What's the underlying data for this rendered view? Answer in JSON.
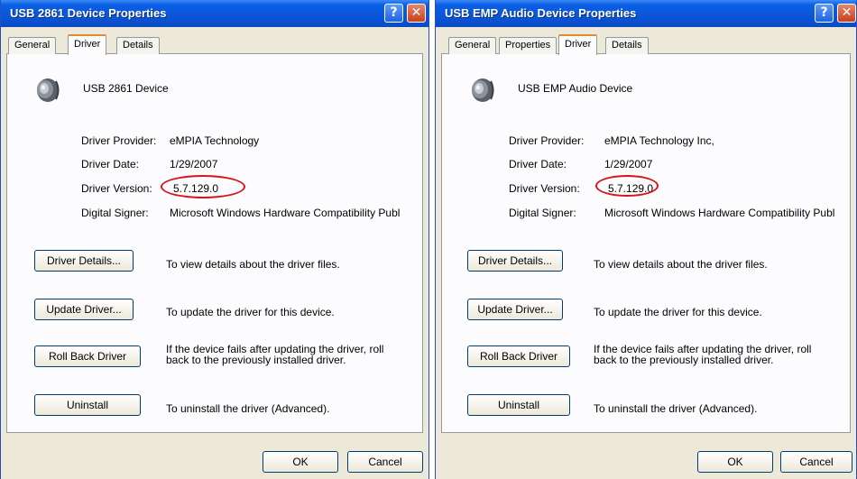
{
  "windows": [
    {
      "title": "USB 2861 Device Properties",
      "help_glyph": "?",
      "close_glyph": "✕",
      "tabs": [
        {
          "label": "General"
        },
        {
          "label": "Driver"
        },
        {
          "label": "Details"
        }
      ],
      "active_tab": "Driver",
      "device_icon": "speaker-icon",
      "device_name": "USB 2861 Device",
      "fields": [
        {
          "label": "Driver Provider:",
          "value": "eMPIA Technology"
        },
        {
          "label": "Driver Date:",
          "value": "1/29/2007"
        },
        {
          "label": "Driver Version:",
          "value": "5.7.129.0"
        },
        {
          "label": "Digital Signer:",
          "value": "Microsoft Windows Hardware Compatibility Publ"
        }
      ],
      "actions": [
        {
          "button": "Driver Details...",
          "description": "To view details about the driver files."
        },
        {
          "button": "Update Driver...",
          "description": "To update the driver for this device."
        },
        {
          "button": "Roll Back Driver",
          "description_line1": "If the device fails after updating the driver, roll",
          "description_line2": "back to the previously installed driver."
        },
        {
          "button": "Uninstall",
          "description": "To uninstall the driver (Advanced)."
        }
      ],
      "ok_label": "OK",
      "cancel_label": "Cancel"
    },
    {
      "title": "USB EMP Audio Device Properties",
      "help_glyph": "?",
      "close_glyph": "✕",
      "tabs": [
        {
          "label": "General"
        },
        {
          "label": "Properties"
        },
        {
          "label": "Driver"
        },
        {
          "label": "Details"
        }
      ],
      "active_tab": "Driver",
      "device_icon": "speaker-icon",
      "device_name": "USB EMP Audio Device",
      "fields": [
        {
          "label": "Driver Provider:",
          "value": "eMPIA Technology Inc,"
        },
        {
          "label": "Driver Date:",
          "value": "1/29/2007"
        },
        {
          "label": "Driver Version:",
          "value": "5.7.129.0"
        },
        {
          "label": "Digital Signer:",
          "value": "Microsoft Windows Hardware Compatibility Publ"
        }
      ],
      "actions": [
        {
          "button": "Driver Details...",
          "description": "To view details about the driver files."
        },
        {
          "button": "Update Driver...",
          "description": "To update the driver for this device."
        },
        {
          "button": "Roll Back Driver",
          "description_line1": "If the device fails after updating the driver, roll",
          "description_line2": "back to the previously installed driver."
        },
        {
          "button": "Uninstall",
          "description": "To uninstall the driver (Advanced)."
        }
      ],
      "ok_label": "OK",
      "cancel_label": "Cancel"
    }
  ],
  "colors": {
    "titlebar": "#0a5fe4",
    "dialog_bg": "#ece9d8",
    "highlight_circle": "#d8131c",
    "active_tab_accent": "#e68b2c"
  }
}
